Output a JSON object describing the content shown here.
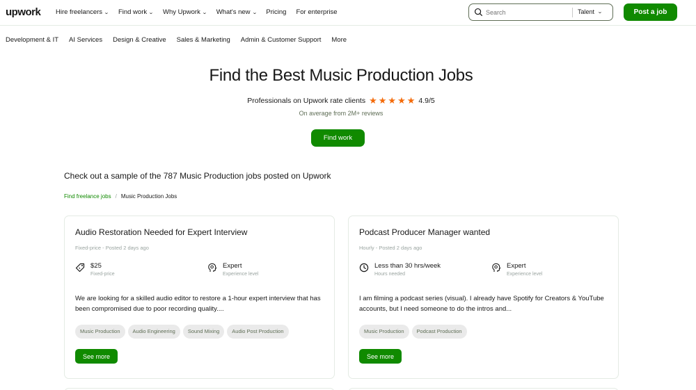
{
  "header": {
    "logo": "upwork",
    "nav": [
      {
        "label": "Hire freelancers",
        "chevron": true
      },
      {
        "label": "Find work",
        "chevron": true
      },
      {
        "label": "Why Upwork",
        "chevron": true
      },
      {
        "label": "What's new",
        "chevron": true
      },
      {
        "label": "Pricing",
        "chevron": false
      },
      {
        "label": "For enterprise",
        "chevron": false
      }
    ],
    "search": {
      "placeholder": "Search",
      "scope": "Talent"
    },
    "post_job": "Post a job"
  },
  "categories": [
    "Development & IT",
    "AI Services",
    "Design & Creative",
    "Sales & Marketing",
    "Admin & Customer Support",
    "More"
  ],
  "hero": {
    "title": "Find the Best Music Production Jobs",
    "rating_text": "Professionals on Upwork rate clients",
    "stars": 5,
    "rating_value": "4.9/5",
    "average": "On average from 2M+ reviews",
    "cta": "Find work"
  },
  "sample_heading": "Check out a sample of the 787 Music Production jobs posted on Upwork",
  "breadcrumb": {
    "root": "Find freelance jobs",
    "current": "Music Production Jobs"
  },
  "jobs": [
    {
      "title": "Audio Restoration Needed for Expert Interview",
      "meta": "Fixed-price - Posted 2 days ago",
      "feature1": {
        "icon": "price-tag-icon",
        "main": "$25",
        "sub": "Fixed-price"
      },
      "feature2": {
        "icon": "expert-head-icon",
        "main": "Expert",
        "sub": "Experience level"
      },
      "description": "We are looking for a skilled audio editor to restore a 1-hour expert interview that has been compromised due to poor recording quality....",
      "skills": [
        "Music Production",
        "Audio Engineering",
        "Sound Mixing",
        "Audio Post Production"
      ],
      "cta": "See more"
    },
    {
      "title": "Podcast Producer Manager wanted",
      "meta": "Hourly - Posted 2 days ago",
      "feature1": {
        "icon": "clock-icon",
        "main": "Less than 30 hrs/week",
        "sub": "Hours needed"
      },
      "feature2": {
        "icon": "expert-head-icon",
        "main": "Expert",
        "sub": "Experience level"
      },
      "description": "I am filming a podcast series (visual). I already have Spotify for Creators & YouTube accounts, but I need someone to do the intros and...",
      "skills": [
        "Music Production",
        "Podcast Production"
      ],
      "cta": "See more"
    }
  ],
  "colors": {
    "brand": "#108a00",
    "star": "#f46b0a",
    "text": "#181818",
    "muted": "#5e6d55"
  }
}
